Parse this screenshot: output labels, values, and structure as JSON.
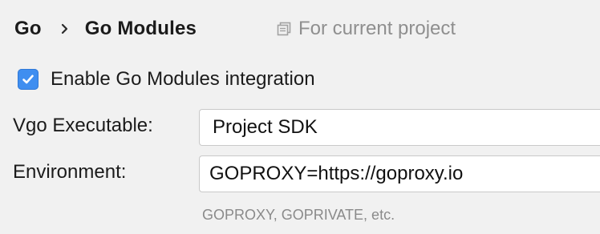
{
  "breadcrumb": {
    "items": [
      {
        "label": "Go"
      },
      {
        "label": "Go Modules"
      }
    ]
  },
  "scope": {
    "label": "For current project",
    "icon": "project-scope-icon"
  },
  "enable_modules": {
    "label": "Enable Go Modules integration",
    "checked": true,
    "color": "#3f8ef0"
  },
  "vgo_executable": {
    "label": "Vgo Executable:",
    "value": "Project SDK"
  },
  "environment": {
    "label": "Environment:",
    "value": "GOPROXY=https://goproxy.io",
    "hint": "GOPROXY, GOPRIVATE, etc."
  }
}
